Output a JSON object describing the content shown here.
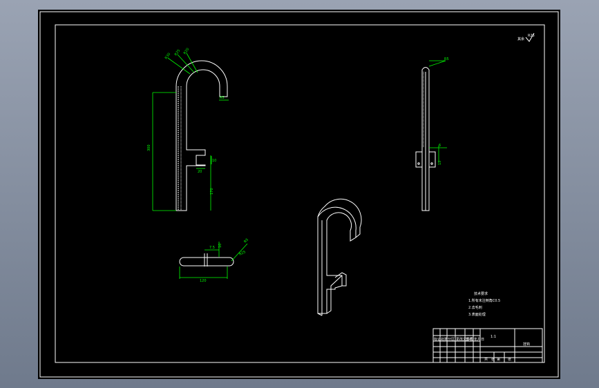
{
  "drawing": {
    "dimensions": {
      "height_total": "300",
      "lower_segment": "170",
      "slot_depth": "10",
      "slot_width": "20",
      "hook_inner_radius": "R5",
      "r1": "R30",
      "r2": "R25",
      "r3": "R20",
      "top_view_length": "120",
      "top_view_offset": "7.5",
      "top_view_h": "10",
      "top_view_r": "R5",
      "side_r": "R5",
      "side_w": "6",
      "side_h": "15"
    },
    "notes": {
      "title": "技术要求",
      "line1": "1.所有未注倒角C0.5",
      "line2": "2.去毛刺",
      "line3": "3.表面处理"
    },
    "roughness": "其余",
    "title_block": {
      "part_name": "挂钩",
      "scale_label": "1:1",
      "col_labels": [
        "标记",
        "处数",
        "分区",
        "更改文件号",
        "签名",
        "年月日"
      ],
      "footer": [
        "共",
        "张",
        "第",
        "张"
      ]
    }
  }
}
